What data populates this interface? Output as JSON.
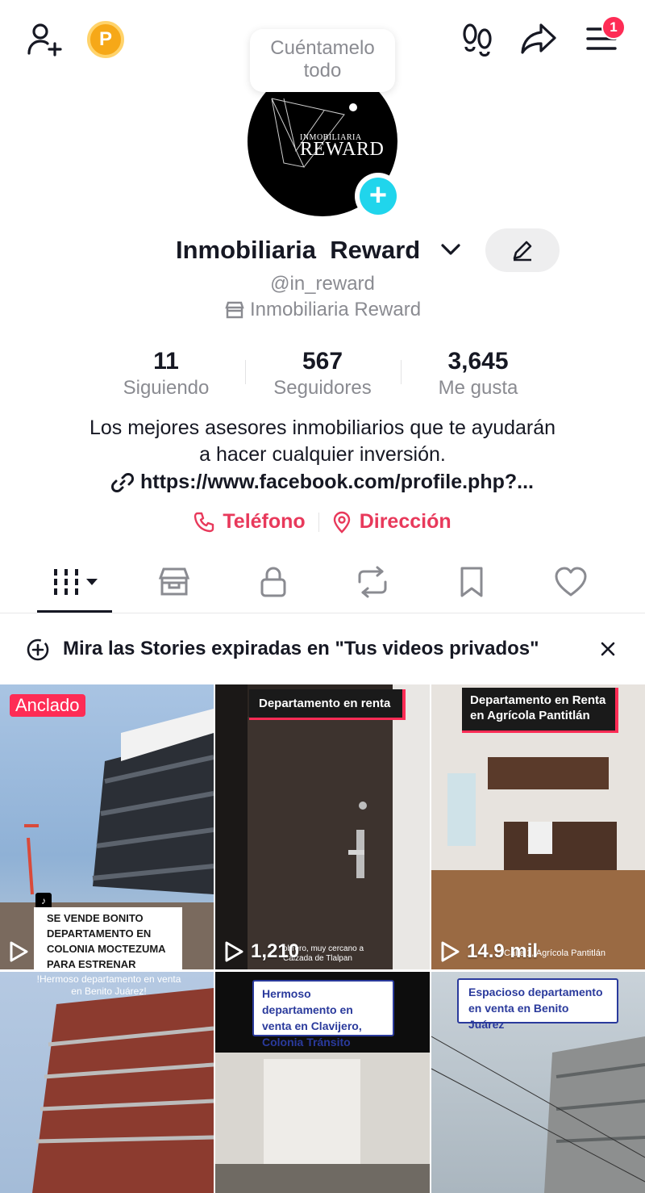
{
  "header": {
    "add_friend_icon": "person-plus-icon",
    "coin_letter": "P",
    "footprints_icon": "footprints-icon",
    "share_icon": "share-arrow-icon",
    "menu_icon": "hamburger-menu-icon",
    "notification_count": "1"
  },
  "bubble": {
    "line1": "Cuéntamelo",
    "line2": "todo"
  },
  "avatar": {
    "small_text": "INMOBILIARIA",
    "big_text": "REWARD"
  },
  "profile": {
    "name": "Inmobiliaria  Reward",
    "handle": "@in_reward",
    "business": "Inmobiliaria Reward"
  },
  "stats": [
    {
      "value": "11",
      "label": "Siguiendo"
    },
    {
      "value": "567",
      "label": "Seguidores"
    },
    {
      "value": "3,645",
      "label": "Me gusta"
    }
  ],
  "bio": {
    "line1": "Los mejores asesores inmobiliarios que te ayudarán",
    "line2": "a hacer cualquier inversión.",
    "link": "https://www.facebook.com/profile.php?..."
  },
  "contact": {
    "phone": "Teléfono",
    "address": "Dirección"
  },
  "notice": {
    "text": "Mira las Stories expiradas en \"Tus videos privados\""
  },
  "videos": [
    {
      "pinned": "Anclado",
      "caption": "SE VENDE BONITO DEPARTAMENTO EN COLONIA MOCTEZUMA PARA ESTRENAR",
      "views": ""
    },
    {
      "caption": "Departamento en renta",
      "overlay": "obrero, muy cercano a Calzada de Tlalpan",
      "views": "1,210"
    },
    {
      "caption": "Departamento en Renta en Agrícola Pantitlán",
      "overlay": "Calle 1, Agrícola Pantitlán",
      "views": "14.9 mil"
    },
    {
      "caption": "!Hermoso departamento en venta en Benito Juárez!",
      "views": ""
    },
    {
      "caption": "Hermoso departamento en venta en Clavijero, Colonia Tránsito",
      "views": ""
    },
    {
      "caption": "Espacioso departamento en venta en Benito Juárez",
      "views": ""
    }
  ],
  "colors": {
    "accent": "#fe2c55",
    "contact": "#e8395b",
    "verified_plus": "#20d5ec",
    "muted": "#8a8b91"
  }
}
